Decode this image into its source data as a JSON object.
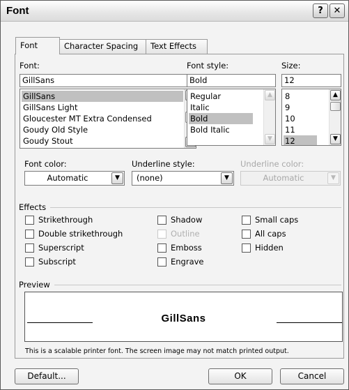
{
  "window": {
    "title": "Font",
    "help_glyph": "?",
    "close_glyph": "✕"
  },
  "tabs": [
    {
      "label": "Font",
      "mnemonic": "n"
    },
    {
      "label": "Character Spacing",
      "mnemonic": "r"
    },
    {
      "label": "Text Effects",
      "mnemonic": "x"
    }
  ],
  "font": {
    "label": "Font:",
    "value": "GillSans",
    "items": [
      "GillSans",
      "GillSans Light",
      "Gloucester MT Extra Condensed",
      "Goudy Old Style",
      "Goudy Stout"
    ],
    "selected_index": 0
  },
  "font_style": {
    "label": "Font style:",
    "value": "Bold",
    "items": [
      "Regular",
      "Italic",
      "Bold",
      "Bold Italic"
    ],
    "selected_index": 2
  },
  "size": {
    "label": "Size:",
    "value": "12",
    "items": [
      "8",
      "9",
      "10",
      "11",
      "12"
    ],
    "selected_index": 4
  },
  "font_color": {
    "label": "Font color:",
    "value": "Automatic"
  },
  "underline_style": {
    "label": "Underline style:",
    "value": "(none)"
  },
  "underline_color": {
    "label": "Underline color:",
    "value": "Automatic",
    "enabled": false
  },
  "effects": {
    "label": "Effects",
    "col1": [
      {
        "label": "Strikethrough",
        "checked": false,
        "enabled": true
      },
      {
        "label": "Double strikethrough",
        "checked": false,
        "enabled": true
      },
      {
        "label": "Superscript",
        "checked": false,
        "enabled": true
      },
      {
        "label": "Subscript",
        "checked": false,
        "enabled": true
      }
    ],
    "col2": [
      {
        "label": "Shadow",
        "checked": false,
        "enabled": true
      },
      {
        "label": "Outline",
        "checked": false,
        "enabled": false
      },
      {
        "label": "Emboss",
        "checked": false,
        "enabled": true
      },
      {
        "label": "Engrave",
        "checked": false,
        "enabled": true
      }
    ],
    "col3": [
      {
        "label": "Small caps",
        "checked": false,
        "enabled": true
      },
      {
        "label": "All caps",
        "checked": false,
        "enabled": true
      },
      {
        "label": "Hidden",
        "checked": false,
        "enabled": true
      }
    ]
  },
  "preview": {
    "label": "Preview",
    "sample_text": "GillSans",
    "note": "This is a scalable printer font. The screen image may not match printed output."
  },
  "buttons": {
    "default": "Default...",
    "ok": "OK",
    "cancel": "Cancel"
  },
  "icons": {
    "help": "help-icon",
    "close": "close-icon",
    "dropdown": "chevron-down-icon",
    "scroll_up": "chevron-up-icon",
    "scroll_down": "chevron-down-icon"
  },
  "colors": {
    "selection": "#c0c0c0",
    "dialog_bg": "#f3f3f3",
    "disabled_text": "#a8a8a8"
  }
}
